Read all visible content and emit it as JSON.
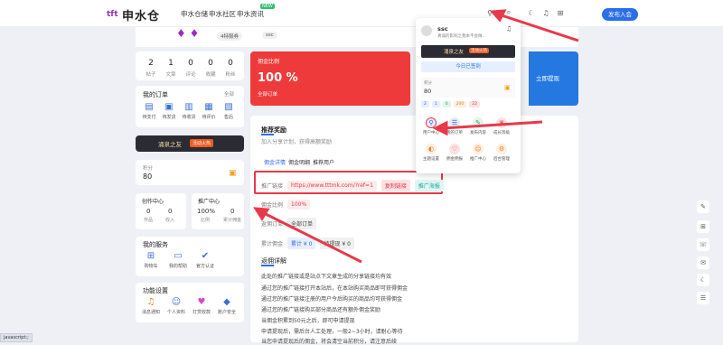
{
  "brand": {
    "logo_text": "申水仓",
    "logo_mark": "tft"
  },
  "nav": {
    "items": [
      {
        "label": "申水仓储"
      },
      {
        "label": "申水社区"
      },
      {
        "label": "申水资讯",
        "badge": "NEW"
      }
    ],
    "publish_label": "发布入会"
  },
  "banner": {
    "badges": [
      "4特服券",
      "ssc"
    ]
  },
  "stats": [
    {
      "value": "2",
      "label": "帖子"
    },
    {
      "value": "1",
      "label": "文章"
    },
    {
      "value": "0",
      "label": "评论"
    },
    {
      "value": "0",
      "label": "收藏"
    },
    {
      "value": "0",
      "label": "粉丝"
    }
  ],
  "orders": {
    "title": "我的订单",
    "all": "全部",
    "items": [
      "待支付",
      "待发货",
      "待收货",
      "待评价",
      "售后"
    ]
  },
  "vip_card": {
    "label": "涌泉之友",
    "badge": "活动火热"
  },
  "points": {
    "label": "积分",
    "value": "80"
  },
  "creator": {
    "title": "创作中心",
    "cells": [
      {
        "v": "0",
        "l": "作品"
      },
      {
        "v": "0",
        "l": "收入"
      }
    ]
  },
  "promo": {
    "title": "推广中心",
    "cells": [
      {
        "v": "100%",
        "l": "比例"
      },
      {
        "v": "0",
        "l": "累计佣金"
      }
    ]
  },
  "services": {
    "title": "我的服务",
    "items": [
      "购物车",
      "我的帮助",
      "官方认证"
    ]
  },
  "settings": {
    "title": "功能设置",
    "items": [
      "消息通知",
      "个人资料",
      "打赏收款",
      "账户安全"
    ]
  },
  "commission": {
    "label": "佣金比例",
    "value": "100 %",
    "sub": "全部订单",
    "withdraw": "立即提现"
  },
  "main": {
    "title": "推荐奖励",
    "subtitle": "加入分享计划，获得高额奖励",
    "tabs": [
      "佣金详情",
      "佣金明细",
      "推荐用户"
    ],
    "link_label": "推广链接",
    "link_value": "https://www.tttmk.com/?ref=1",
    "copy_btn": "复制链接",
    "poster_btn": "推广海报",
    "ratio_label": "佣金比例",
    "ratio_value": "100%",
    "orders_label": "返佣订单",
    "orders_value": "全部订单",
    "amount_label": "累计佣金",
    "total_value": "累计 ¥ 0",
    "pending_value": "待提现 ¥ 0",
    "rules_title": "返佣详解",
    "rules": [
      "此处的推广链接或是站点下文章生成的分享链接均有效",
      "通过您的推广链接打开本站后，在本站购买商品即可获得佣金",
      "通过您的推广链接注册的用户今后购买的商品均可获得佣金",
      "通过您的推广链接购买部分商品还有额外佣金奖励",
      "当佣金积累到50元之后，即可申请提现",
      "申请提现后，需后台人工处理，一般2~3小时，请耐心等待",
      "当您申请提现后的佣金，将会清空当前积分，请注意后续"
    ]
  },
  "popup": {
    "user": "ssc",
    "desc": "真诚的影响之我本不会做...",
    "vip": "涌泉之友",
    "vip_badge": "活动火热",
    "signin": "今日已签到",
    "points_label": "积分",
    "points_value": "80",
    "counters": [
      "2",
      "1",
      "0",
      "200",
      "22"
    ],
    "grid": [
      {
        "label": "用户中心",
        "color": "#3a6fd8",
        "bg": "#e3ecfb",
        "icon": "⚲"
      },
      {
        "label": "我的订单",
        "color": "#3a6fd8",
        "bg": "#e3ecfb",
        "icon": "☰"
      },
      {
        "label": "发布内容",
        "color": "#26a65b",
        "bg": "#e0f5e8",
        "icon": "✎"
      },
      {
        "label": "成长等级",
        "color": "#e8394a",
        "bg": "#fbe3e3",
        "icon": "♛"
      },
      {
        "label": "主题设置",
        "color": "#e87e2c",
        "bg": "#fdeede",
        "icon": "◐"
      },
      {
        "label": "佣金佣报",
        "color": "#e8394a",
        "bg": "#fbe3e3",
        "icon": "♡"
      },
      {
        "label": "推广中心",
        "color": "#e87e2c",
        "bg": "#fdeede",
        "icon": "☺"
      },
      {
        "label": "后台管理",
        "color": "#e87e2c",
        "bg": "#fdeede",
        "icon": "⚙"
      }
    ]
  },
  "status_text": "javascript:;"
}
